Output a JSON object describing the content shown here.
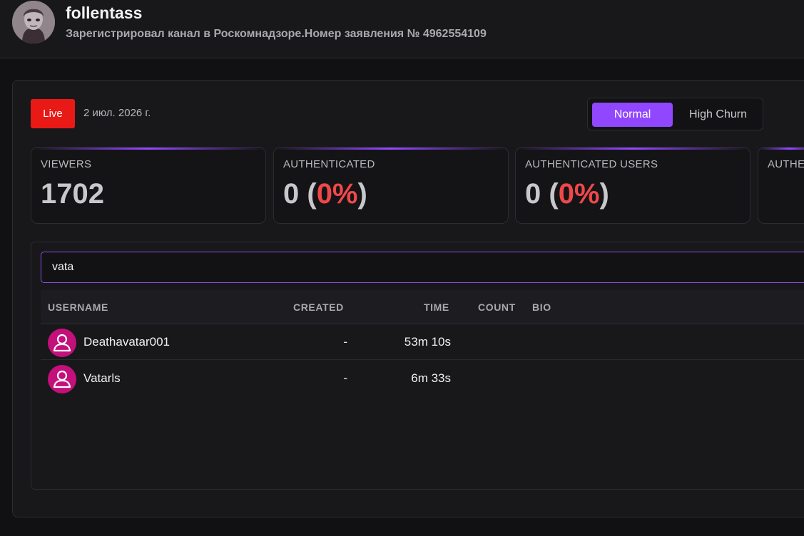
{
  "header": {
    "channel_name": "follentass",
    "description": "Зарегистрировал канал в Роскомнадзоре.Номер заявления № 4962554109"
  },
  "status": {
    "live_label": "Live",
    "date": "2 июл. 2026 г."
  },
  "mode_toggle": {
    "options": [
      "Normal",
      "High Churn"
    ],
    "selected": "Normal"
  },
  "stats": [
    {
      "label": "VIEWERS",
      "value": "1702"
    },
    {
      "label": "AUTHENTICATED",
      "value": "0",
      "open": " (",
      "percent": "0%",
      "close": ")"
    },
    {
      "label": "AUTHENTICATED USERS",
      "value": "0",
      "open": " (",
      "percent": "0%",
      "close": ")"
    },
    {
      "label": "AUTHE"
    }
  ],
  "search": {
    "value": "vata"
  },
  "table": {
    "columns": [
      "USERNAME",
      "CREATED",
      "TIME",
      "COUNT",
      "BIO"
    ],
    "rows": [
      {
        "username": "Deathavatar001",
        "created": "-",
        "time": "53m 10s",
        "count": "",
        "bio": ""
      },
      {
        "username": "Vatarls",
        "created": "-",
        "time": "6m 33s",
        "count": "",
        "bio": ""
      }
    ]
  },
  "colors": {
    "accent": "#9147ff",
    "live": "#e91916",
    "percent": "#f0484a",
    "user_avatar": "#c4107a"
  }
}
